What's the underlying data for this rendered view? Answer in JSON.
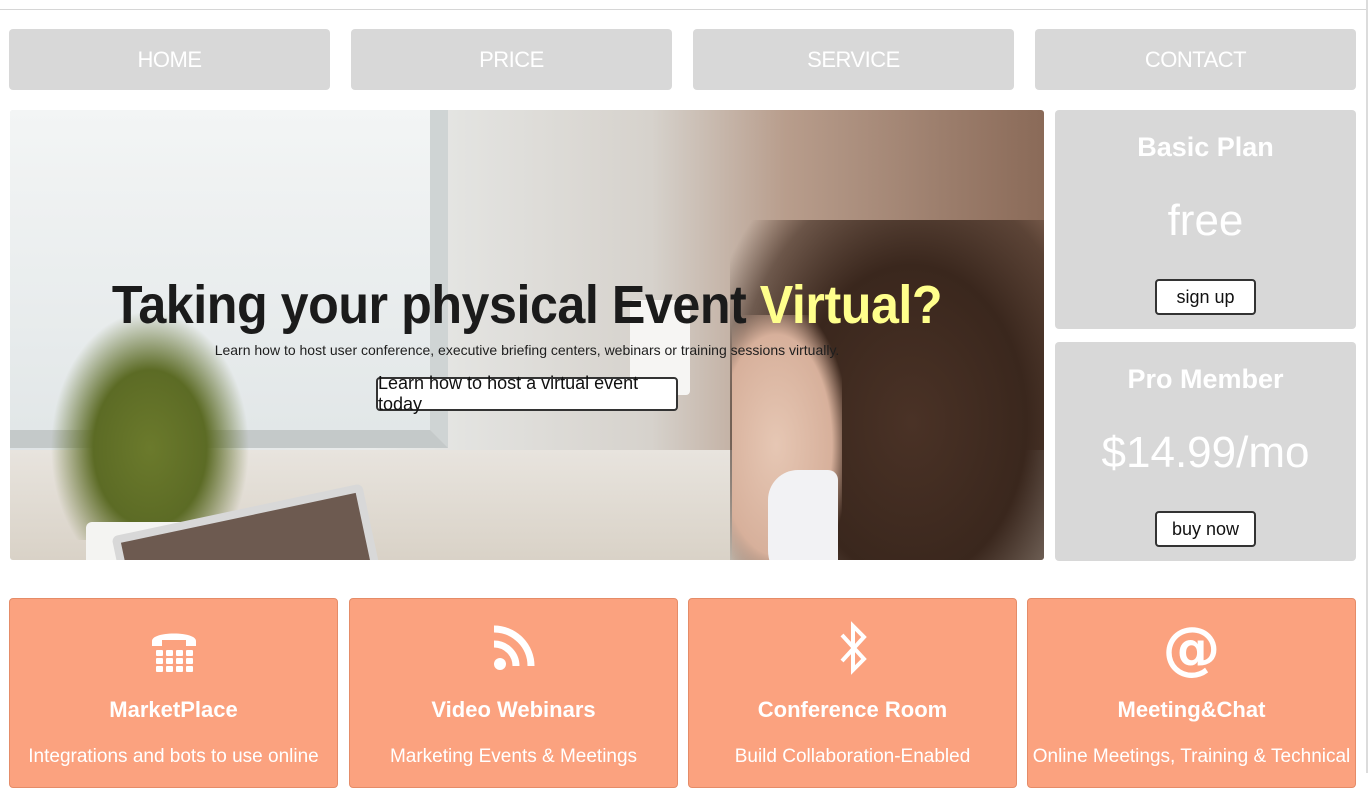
{
  "nav": {
    "items": [
      {
        "label": "HOME"
      },
      {
        "label": "PRICE"
      },
      {
        "label": "SERVICE"
      },
      {
        "label": "CONTACT"
      }
    ]
  },
  "hero": {
    "title_main": "Taking your physical Event ",
    "title_accent": "Virtual?",
    "subtitle": "Learn how to host user conference, executive briefing centers, webinars or training sessions virtually.",
    "cta_label": "Learn how to host a virtual event today",
    "accent_color": "#ffff8c"
  },
  "plans": [
    {
      "title": "Basic Plan",
      "price": "free",
      "button_label": "sign up"
    },
    {
      "title": "Pro Member",
      "price": "$14.99/mo",
      "button_label": "buy now"
    }
  ],
  "services": [
    {
      "icon": "phone-icon",
      "title": "MarketPlace",
      "description": "Integrations and bots to use online"
    },
    {
      "icon": "rss-icon",
      "title": "Video Webinars",
      "description": "Marketing Events & Meetings"
    },
    {
      "icon": "bluetooth-icon",
      "title": "Conference Room",
      "description": "Build Collaboration-Enabled"
    },
    {
      "icon": "at-icon",
      "title": "Meeting&Chat",
      "description": "Online Meetings, Training & Technical"
    }
  ],
  "colors": {
    "nav_bg": "#d8d8d8",
    "service_bg": "#fba27f",
    "plan_bg": "#d8d8d8"
  }
}
